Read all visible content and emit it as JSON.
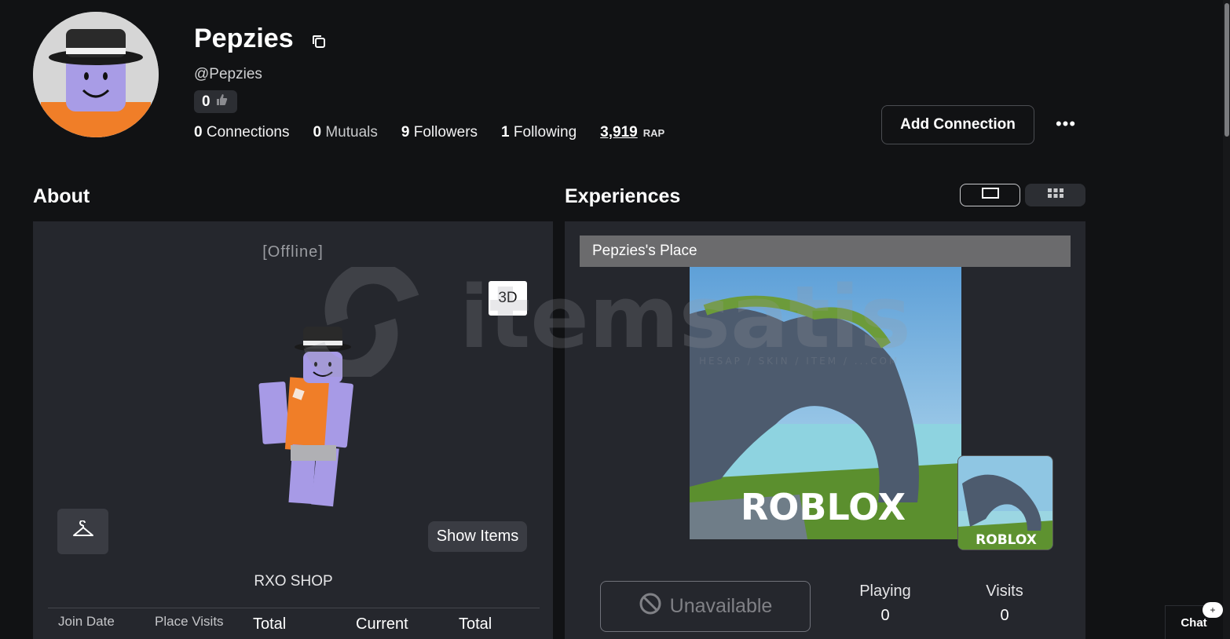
{
  "profile": {
    "display_name": "Pepzies",
    "username": "@Pepzies",
    "likes": "0",
    "stats": {
      "connections_count": "0",
      "connections_label": "Connections",
      "mutuals_count": "0",
      "mutuals_label": "Mutuals",
      "followers_count": "9",
      "followers_label": "Followers",
      "following_count": "1",
      "following_label": "Following",
      "rap_value": "3,919",
      "rap_label": "RAP"
    },
    "add_connection_label": "Add Connection",
    "more_label": "•••"
  },
  "about": {
    "title": "About",
    "status": "[Offline]",
    "view_3d_label": "3D",
    "show_items_label": "Show Items",
    "shop_name": "RXO SHOP",
    "stats_headers": [
      "Join Date",
      "Place Visits",
      "Total",
      "Current",
      "Total"
    ]
  },
  "experiences": {
    "title": "Experiences",
    "place_name": "Pepzies's Place",
    "thumbnail_logo": "ROBLOX",
    "unavailable_label": "Unavailable",
    "playing_label": "Playing",
    "playing_value": "0",
    "visits_label": "Visits",
    "visits_value": "0"
  },
  "watermark": {
    "brand": "itemsatis",
    "tagline": "HESAP / SKIN / ITEM / ...COM"
  },
  "chat": {
    "label": "Chat",
    "badge": "+"
  },
  "colors": {
    "background": "#111214",
    "panel": "#25272d",
    "accent_orange": "#f07e28",
    "avatar_purple": "#a79ae6"
  }
}
